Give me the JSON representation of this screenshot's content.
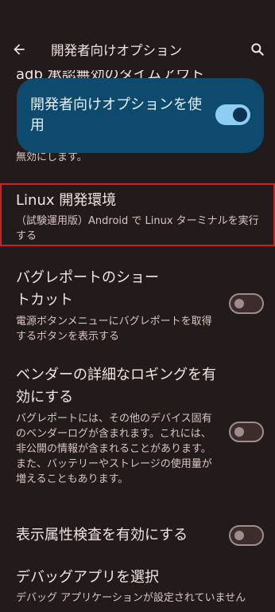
{
  "appbar": {
    "title": "開発者向けオプション",
    "back_icon": "arrow-back-icon",
    "search_icon": "search-icon"
  },
  "colors": {
    "background": "#231b1b",
    "master_card": "#0e4a6e",
    "toggle_on": "#8ecdf4",
    "highlight_border": "#c3252a"
  },
  "partial_item": {
    "title": "adb 承認無効のタイムアウト",
    "summary_fragment": "無効にします。"
  },
  "master_switch": {
    "label": "開発者向けオプションを使用",
    "checked": true
  },
  "items": [
    {
      "title": "Linux 開発環境",
      "summary": "（試験運用版）Android で Linux ターミナルを実行する"
    },
    {
      "title": "バグレポートのショートカット",
      "summary": "電源ボタンメニューにバグレポートを取得するボタンを表示する",
      "checked": false
    },
    {
      "title": "ベンダーの詳細なロギングを有効にする",
      "summary": "バグレポートには、その他のデバイス固有のベンダーログが含まれます。これには、非公開の情報が含まれることがあります。また、バッテリーやストレージの使用量が増えることもあります。",
      "checked": false
    },
    {
      "title": "表示属性検査を有効にする",
      "checked": false
    },
    {
      "title": "デバッグアプリを選択",
      "summary": "デバッグ アプリケーションが設定されていません"
    }
  ]
}
